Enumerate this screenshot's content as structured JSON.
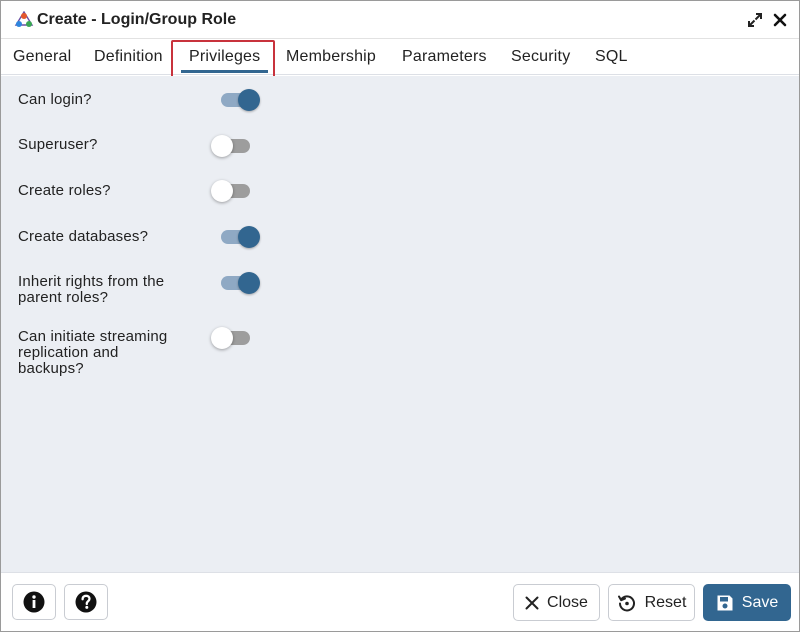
{
  "window": {
    "title": "Create - Login/Group Role"
  },
  "tabs": [
    {
      "label": "General"
    },
    {
      "label": "Definition"
    },
    {
      "label": "Privileges",
      "active": true
    },
    {
      "label": "Membership"
    },
    {
      "label": "Parameters"
    },
    {
      "label": "Security"
    },
    {
      "label": "SQL"
    }
  ],
  "privileges": [
    {
      "label": "Can login?",
      "value": true
    },
    {
      "label": "Superuser?",
      "value": false
    },
    {
      "label": "Create roles?",
      "value": false
    },
    {
      "label": "Create databases?",
      "value": true
    },
    {
      "label": "Inherit rights from the parent roles?",
      "value": true
    },
    {
      "label": "Can initiate streaming replication and backups?",
      "value": false
    }
  ],
  "footer": {
    "close_label": "Close",
    "reset_label": "Reset",
    "save_label": "Save"
  },
  "colors": {
    "accent": "#326690",
    "toggle_on_track": "#8fa9c4",
    "toggle_off_track": "#9d9d9d",
    "content_bg": "#ebeef3",
    "tab_highlight": "#c8323c"
  },
  "icons": {
    "app": "pgadmin-role-icon",
    "expand": "expand-icon",
    "close": "close-icon",
    "info": "info-icon",
    "help": "help-icon",
    "reset": "reset-icon",
    "save": "save-icon"
  }
}
